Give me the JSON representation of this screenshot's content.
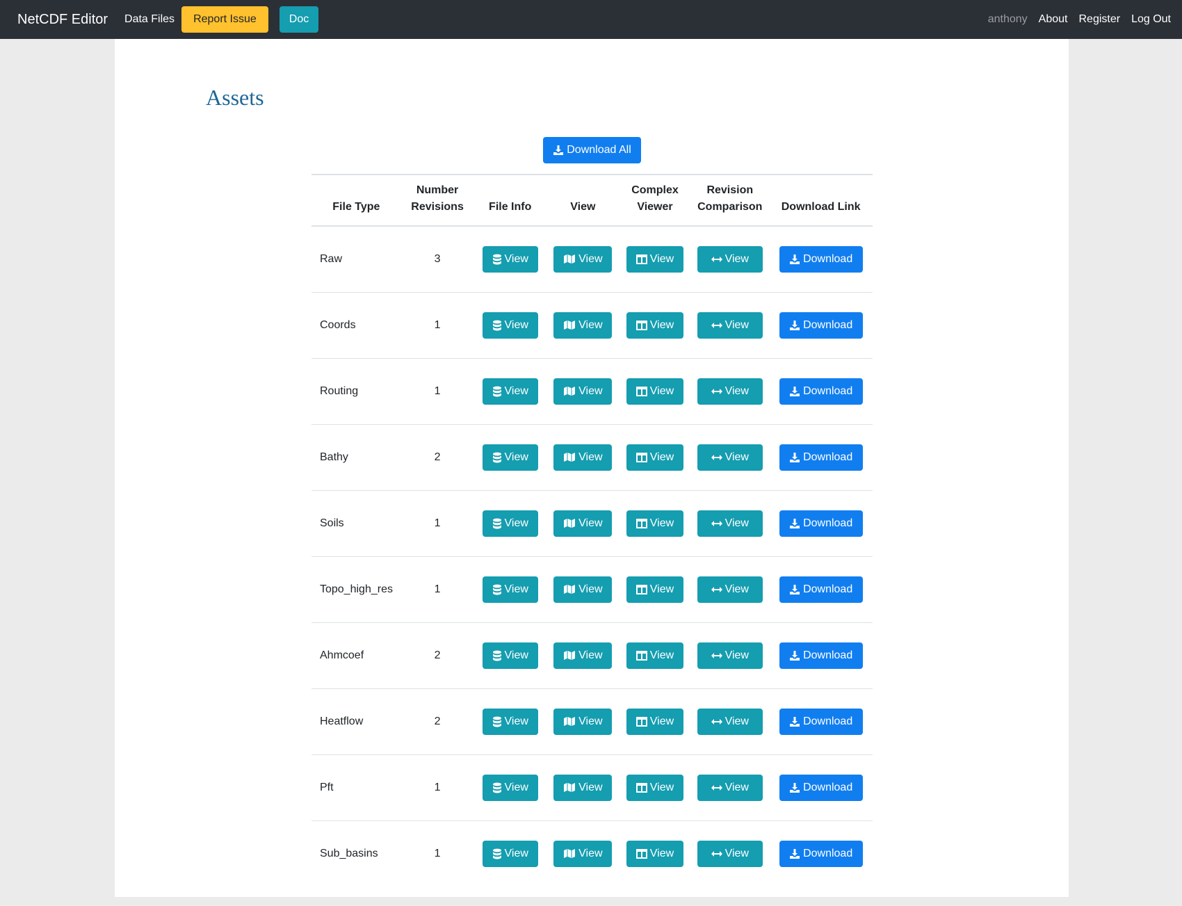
{
  "nav": {
    "brand": "NetCDF Editor",
    "data_files": "Data Files",
    "report_issue": "Report Issue",
    "doc": "Doc",
    "user": "anthony",
    "about": "About",
    "register": "Register",
    "logout": "Log Out"
  },
  "page": {
    "title": "Assets",
    "download_all": "Download All"
  },
  "table": {
    "headers": {
      "file_type": "File Type",
      "revisions_1": "Number",
      "revisions_2": "Revisions",
      "file_info": "File Info",
      "view": "View",
      "complex_1": "Complex",
      "complex_2": "Viewer",
      "revision_1": "Revision",
      "revision_2": "Comparison",
      "download": "Download Link"
    },
    "view_label": "View",
    "download_label": "Download",
    "rows": [
      {
        "file_type": "Raw",
        "revisions": "3"
      },
      {
        "file_type": "Coords",
        "revisions": "1"
      },
      {
        "file_type": "Routing",
        "revisions": "1"
      },
      {
        "file_type": "Bathy",
        "revisions": "2"
      },
      {
        "file_type": "Soils",
        "revisions": "1"
      },
      {
        "file_type": "Topo_high_res",
        "revisions": "1"
      },
      {
        "file_type": "Ahmcoef",
        "revisions": "2"
      },
      {
        "file_type": "Heatflow",
        "revisions": "2"
      },
      {
        "file_type": "Pft",
        "revisions": "1"
      },
      {
        "file_type": "Sub_basins",
        "revisions": "1"
      }
    ]
  },
  "colors": {
    "navbar": "#2b2f36",
    "primary": "#117ef0",
    "info": "#159db0",
    "warning": "#ffc12d",
    "title": "#1f6797"
  },
  "icons": {
    "file_info": "database-icon",
    "view": "map-icon",
    "complex": "columns-icon",
    "revision": "arrows-h-icon",
    "download": "download-icon"
  }
}
